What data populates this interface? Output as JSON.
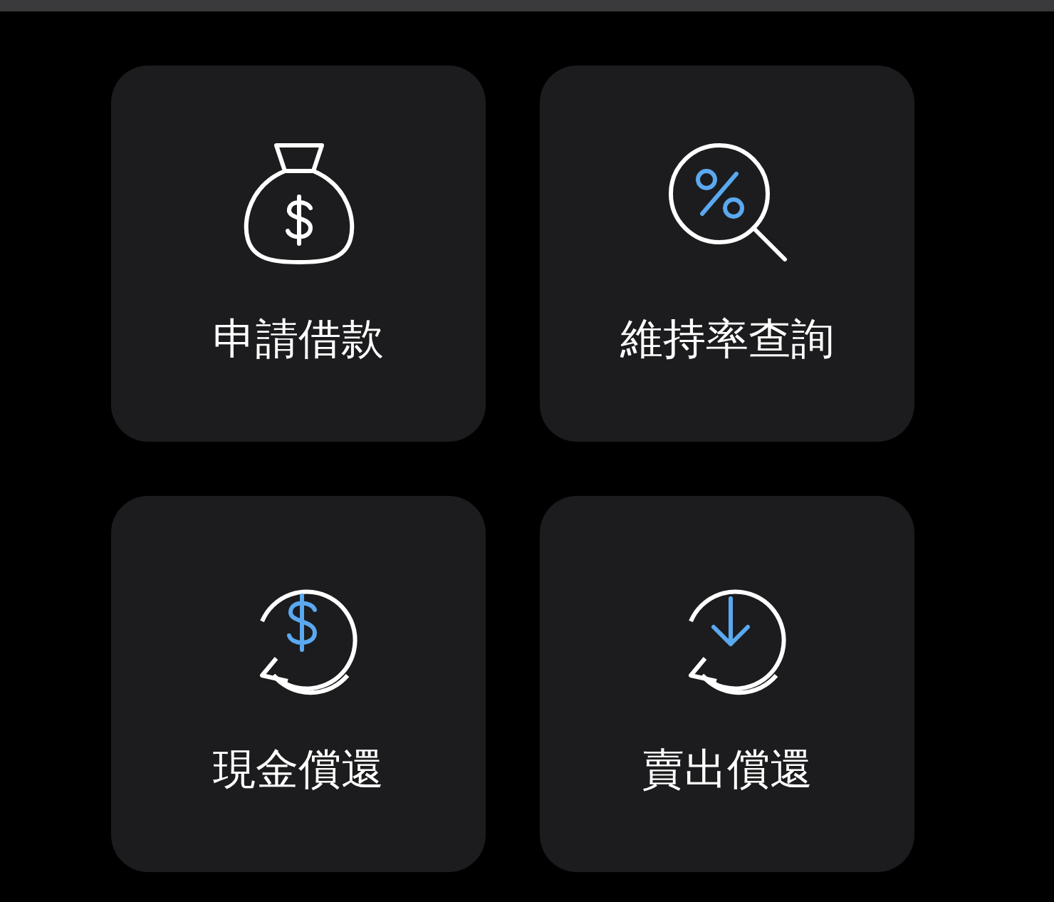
{
  "tiles": [
    {
      "kind": "bag",
      "label": "申請借款"
    },
    {
      "kind": "percent",
      "label": "維持率查詢"
    },
    {
      "kind": "cash",
      "label": "現金償還"
    },
    {
      "kind": "sell",
      "label": "賣出償還"
    }
  ]
}
